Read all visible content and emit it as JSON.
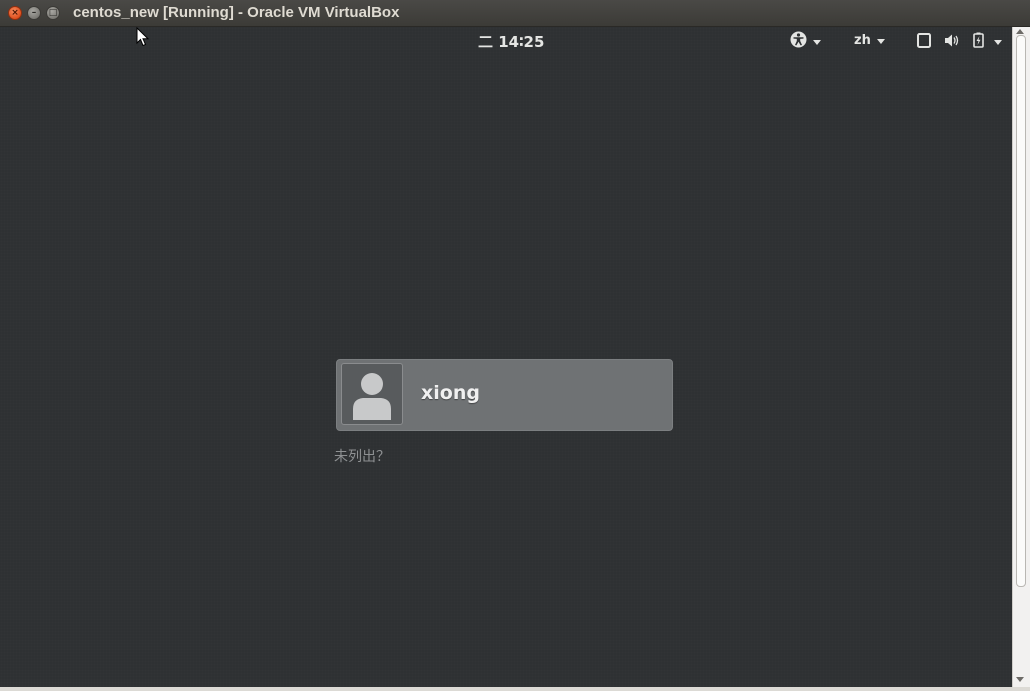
{
  "window": {
    "title": "centos_new [Running] - Oracle VM VirtualBox",
    "close_glyph": "×",
    "minimize_glyph": "–",
    "maximize_glyph": "□"
  },
  "topbar": {
    "clock": "二 14∶25",
    "accessibility_icon": "accessibility-icon",
    "language": "zh",
    "display_icon": "display-icon",
    "volume_icon": "volume-icon",
    "battery_icon": "battery-icon"
  },
  "login": {
    "users": [
      {
        "name": "xiong",
        "avatar_icon": "default-user-avatar-icon"
      }
    ],
    "not_listed_label": "未列出？"
  },
  "colors": {
    "background": "#2e3133",
    "user_row": "#6f7274",
    "title_bar": "#3c3b37"
  }
}
